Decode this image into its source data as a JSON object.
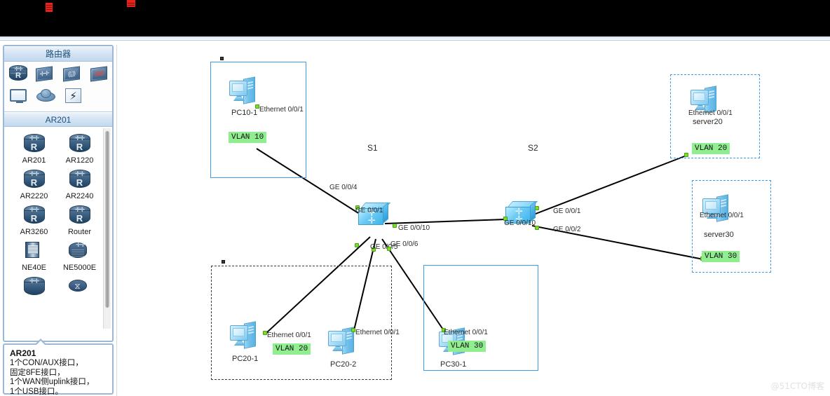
{
  "app": {
    "watermark": "@51CTO博客"
  },
  "dock": {
    "section_title": "路由器",
    "category_title": "AR201",
    "quick_icons": [
      {
        "name": "router-icon",
        "label": "Router"
      },
      {
        "name": "switch-icon",
        "label": "Switch"
      },
      {
        "name": "wlan-ap-icon",
        "label": "WLAN"
      },
      {
        "name": "firewall-icon",
        "label": "Firewall"
      },
      {
        "name": "pc-icon",
        "label": "PC"
      },
      {
        "name": "cloud-icon",
        "label": "Cloud"
      },
      {
        "name": "connection-icon",
        "label": "Connection"
      }
    ],
    "devices": [
      {
        "label": "AR201",
        "icon": "router-icon"
      },
      {
        "label": "AR1220",
        "icon": "router-icon"
      },
      {
        "label": "AR2220",
        "icon": "router-icon"
      },
      {
        "label": "AR2240",
        "icon": "router-icon"
      },
      {
        "label": "AR3260",
        "icon": "router-icon"
      },
      {
        "label": "Router",
        "icon": "router-icon"
      },
      {
        "label": "NE40E",
        "icon": "ne40e-icon"
      },
      {
        "label": "NE5000E",
        "icon": "ne5000e-icon"
      }
    ]
  },
  "description": {
    "title": "AR201",
    "lines": [
      "1个CON/AUX接口，",
      "固定8FE接口，",
      "1个WAN侧uplink接口，",
      "1个USB接口。"
    ]
  },
  "topology": {
    "groups": [
      {
        "id": "grp-vlan10",
        "style": "solid-blue",
        "vlan": "VLAN 10"
      },
      {
        "id": "grp-vlan20s",
        "style": "dot-blue",
        "vlan": "VLAN 20"
      },
      {
        "id": "grp-vlan30s",
        "style": "dot-blue",
        "vlan": "VLAN 30"
      },
      {
        "id": "grp-vlan20p",
        "style": "dot-dark",
        "vlan": "VLAN 20"
      },
      {
        "id": "grp-vlan30p",
        "style": "solid-blue",
        "vlan": "VLAN 30"
      }
    ],
    "nodes": [
      {
        "id": "pc10_1",
        "label": "PC10-1",
        "type": "pc"
      },
      {
        "id": "s1",
        "label": "S1",
        "type": "switch"
      },
      {
        "id": "s2",
        "label": "S2",
        "type": "switch"
      },
      {
        "id": "server20",
        "label": "server20",
        "type": "pc"
      },
      {
        "id": "server30",
        "label": "server30",
        "type": "pc"
      },
      {
        "id": "pc20_1",
        "label": "PC20-1",
        "type": "pc"
      },
      {
        "id": "pc20_2",
        "label": "PC20-2",
        "type": "pc"
      },
      {
        "id": "pc30_1",
        "label": "PC30-1",
        "type": "pc"
      }
    ],
    "port_labels": [
      {
        "id": "p_pc10",
        "text": "Ethernet 0/0/1"
      },
      {
        "id": "p_s1_1",
        "text": "GE 0/0/1"
      },
      {
        "id": "p_s1_10",
        "text": "GE 0/0/10"
      },
      {
        "id": "p_s1_4",
        "text": "GE 0/0/4"
      },
      {
        "id": "p_s1_5",
        "text": "GE 0/0/5"
      },
      {
        "id": "p_s1_6",
        "text": "GE 0/0/6"
      },
      {
        "id": "p_s2_10",
        "text": "GE 0/0/10"
      },
      {
        "id": "p_s2_1",
        "text": "GE 0/0/1"
      },
      {
        "id": "p_s2_2",
        "text": "GE 0/0/2"
      },
      {
        "id": "p_srv20",
        "text": "Ethernet 0/0/1"
      },
      {
        "id": "p_srv30",
        "text": "Ethernet 0/0/1"
      },
      {
        "id": "p_pc20_1",
        "text": "Ethernet 0/0/1"
      },
      {
        "id": "p_pc20_2",
        "text": "Ethernet 0/0/1"
      },
      {
        "id": "p_pc30_1",
        "text": "Ethernet 0/0/1"
      }
    ],
    "vlan_tags": {
      "vlan10": "VLAN 10",
      "vlan20_server": "VLAN 20",
      "vlan30_server": "VLAN 30",
      "vlan20_pc": "VLAN 20",
      "vlan30_pc": "VLAN 30"
    }
  },
  "colors": {
    "accent_blue": "#3d9aee",
    "vlan_green": "#90ee90",
    "port_dot": "#7cdc2a",
    "link": "#000000",
    "panel_border": "#9db8d6"
  }
}
